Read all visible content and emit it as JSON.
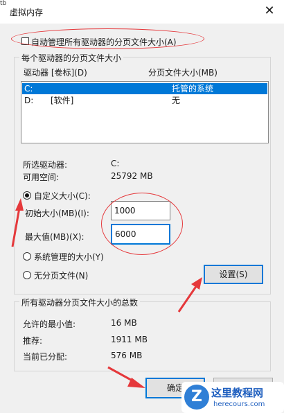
{
  "window": {
    "title": "虚拟内存",
    "close_glyph": "✕"
  },
  "top_mark": "tb",
  "auto_manage": {
    "label": "自动管理所有驱动器的分页文件大小(A)",
    "checked": false
  },
  "drives_group": {
    "legend": "每个驱动器的分页文件大小",
    "col_drive": "驱动器 [卷标](D)",
    "col_size": "分页文件大小(MB)",
    "rows": [
      {
        "drive": "C:",
        "label": "",
        "size": "托管的系统",
        "selected": true
      },
      {
        "drive": "D:",
        "label": "[软件]",
        "size": "无",
        "selected": false
      }
    ]
  },
  "selected_drive": {
    "label": "所选驱动器:",
    "value": "C:"
  },
  "free_space": {
    "label": "可用空间:",
    "value": "25792 MB"
  },
  "custom_size": {
    "label": "自定义大小(C):",
    "checked": true
  },
  "initial_size": {
    "label": "初始大小(MB)(I):",
    "value": "1000"
  },
  "max_size": {
    "label": "最大值(MB)(X):",
    "value": "6000"
  },
  "system_managed": {
    "label": "系统管理的大小(Y)",
    "checked": false
  },
  "no_paging": {
    "label": "无分页文件(N)",
    "checked": false
  },
  "set_button": "设置(S)",
  "totals_group": {
    "legend": "所有驱动器分页文件大小的总数",
    "min_label": "允许的最小值:",
    "min_value": "16 MB",
    "recommended_label": "推荐:",
    "recommended_value": "1911 MB",
    "current_label": "当前已分配:",
    "current_value": "576 MB"
  },
  "ok_button": "确定",
  "watermark": {
    "logo": "Z",
    "name": "这里教程网",
    "url": "herecours.com"
  },
  "colors": {
    "selection": "#0078d7",
    "annotation_red": "#e5383b",
    "watermark_blue": "#1f5fbf"
  }
}
